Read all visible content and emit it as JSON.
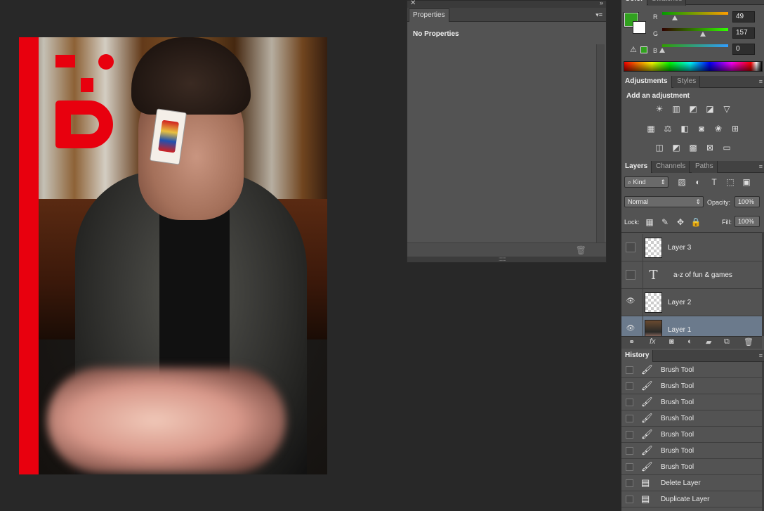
{
  "properties_panel": {
    "tab_label": "Properties",
    "message": "No Properties"
  },
  "color_panel": {
    "tabs": [
      "Color",
      "Swatches"
    ],
    "foreground": "#31a11f",
    "background": "#ffffff",
    "channels": [
      {
        "label": "R",
        "value": "49"
      },
      {
        "label": "G",
        "value": "157"
      },
      {
        "label": "B",
        "value": "0"
      }
    ]
  },
  "adjustments_panel": {
    "tabs": [
      "Adjustments",
      "Styles"
    ],
    "title": "Add an adjustment",
    "icons_row1": [
      "brightness-contrast-icon",
      "levels-icon",
      "curves-icon",
      "exposure-icon",
      "vibrance-icon"
    ],
    "icons_row2": [
      "hue-saturation-icon",
      "color-balance-icon",
      "black-white-icon",
      "photo-filter-icon",
      "channel-mixer-icon",
      "color-lookup-icon"
    ],
    "icons_row3": [
      "invert-icon",
      "posterize-icon",
      "threshold-icon",
      "selective-color-icon",
      "gradient-map-icon"
    ]
  },
  "layers_panel": {
    "tabs": [
      "Layers",
      "Channels",
      "Paths"
    ],
    "filter_kind": "Kind",
    "blend_mode": "Normal",
    "opacity_label": "Opacity:",
    "opacity_value": "100%",
    "lock_label": "Lock:",
    "fill_label": "Fill:",
    "fill_value": "100%",
    "layers": [
      {
        "name": "Layer 3",
        "kind": "pixel",
        "visible": false,
        "selected": false
      },
      {
        "name": "a-z of fun & games",
        "kind": "type",
        "visible": false,
        "selected": false
      },
      {
        "name": "Layer 2",
        "kind": "pixel",
        "visible": true,
        "selected": false
      },
      {
        "name": "Layer 1",
        "kind": "photo",
        "visible": true,
        "selected": true
      }
    ]
  },
  "history_panel": {
    "tab_label": "History",
    "items": [
      {
        "label": "Brush Tool",
        "icon": "brush-icon"
      },
      {
        "label": "Brush Tool",
        "icon": "brush-icon"
      },
      {
        "label": "Brush Tool",
        "icon": "brush-icon"
      },
      {
        "label": "Brush Tool",
        "icon": "brush-icon"
      },
      {
        "label": "Brush Tool",
        "icon": "brush-icon"
      },
      {
        "label": "Brush Tool",
        "icon": "brush-icon"
      },
      {
        "label": "Brush Tool",
        "icon": "brush-icon"
      },
      {
        "label": "Delete Layer",
        "icon": "document-icon"
      },
      {
        "label": "Duplicate Layer",
        "icon": "document-icon"
      }
    ]
  }
}
